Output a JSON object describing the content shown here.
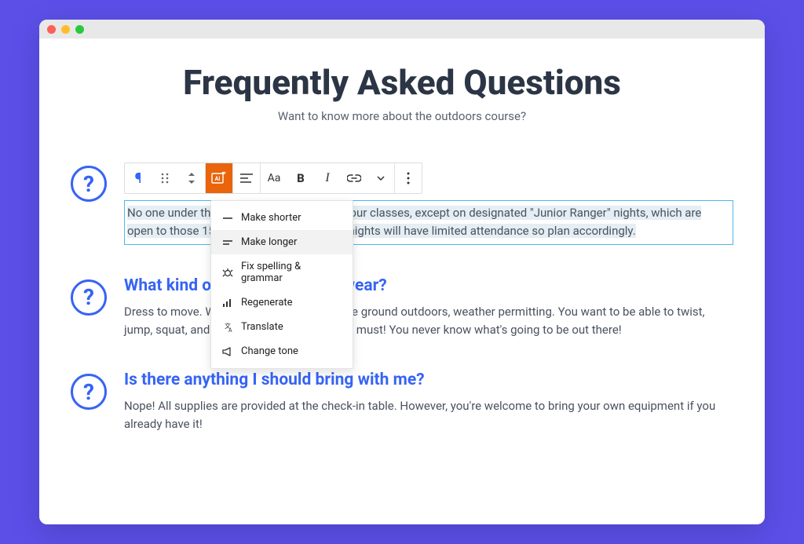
{
  "header": {
    "title": "Frequently Asked Questions",
    "subtitle": "Want to know more about the outdoors course?"
  },
  "toolbar": {
    "paragraph_icon": "¶",
    "ai_badge": "AI",
    "case_label": "Aa",
    "bold_label": "B",
    "italic_label": "I"
  },
  "ai_menu": {
    "items": [
      {
        "label": "Make shorter"
      },
      {
        "label": "Make longer"
      },
      {
        "label": "Fix spelling & grammar"
      },
      {
        "label": "Regenerate"
      },
      {
        "label": "Translate"
      },
      {
        "label": "Change tone"
      }
    ]
  },
  "faq": [
    {
      "answer": "No one under the age of 21 is permitted in our classes, except on designated \"Junior Ranger\" nights, which are open to those 15 and older. Junior Ranger nights will have limited attendance so plan accordingly."
    },
    {
      "question": "What kind of clothes should I wear?",
      "answer": "Dress to move. We spend a lot of time on the ground outdoors, weather permitting. You want to be able to twist, jump, squat, and leap. Also, long pants are a must! You never know what's going to be out there!"
    },
    {
      "question": "Is there anything I should bring with me?",
      "answer": "Nope! All supplies are provided at the check-in table. However, you're welcome to bring your own equipment if you already have it!"
    }
  ]
}
